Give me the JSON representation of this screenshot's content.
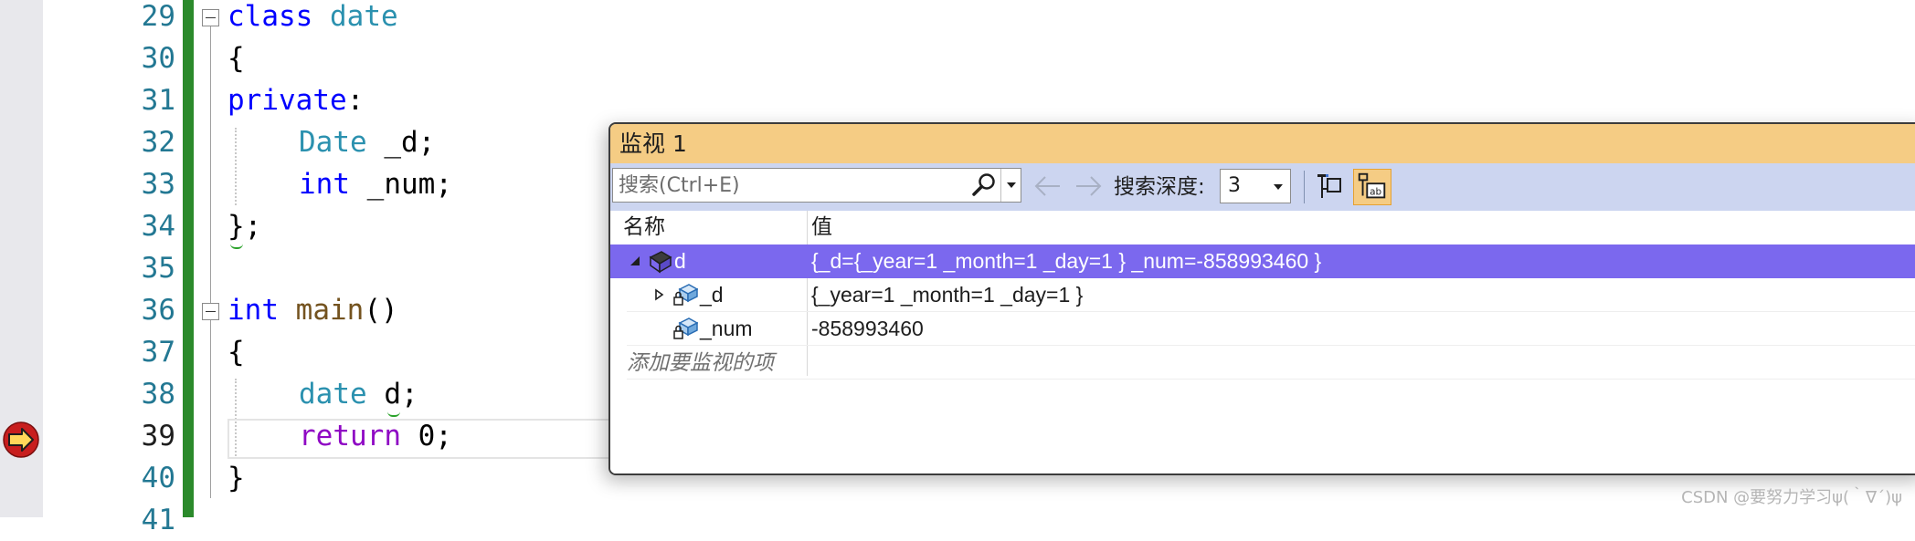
{
  "editor": {
    "line_numbers": [
      "29",
      "30",
      "31",
      "32",
      "33",
      "34",
      "35",
      "36",
      "37",
      "38",
      "39",
      "40",
      "41"
    ],
    "current_line": "39",
    "lines": {
      "l29": {
        "kw": "class",
        "name": "date"
      },
      "l30": {
        "text": "{"
      },
      "l31": {
        "kw": "private",
        "colon": ":"
      },
      "l32": {
        "type": "Date",
        "rest": " _d;"
      },
      "l33": {
        "kw": "int",
        "rest": " _num;"
      },
      "l34": {
        "text": "};"
      },
      "l36": {
        "kw": "int",
        "fn": "main",
        "rest": "()"
      },
      "l37": {
        "text": "{"
      },
      "l38": {
        "type": "date",
        "rest": " d;"
      },
      "l39": {
        "ctl": "return",
        "rest": " 0;"
      },
      "l40": {
        "text": "}"
      }
    },
    "colors": {
      "keyword": "#0000ff",
      "type": "#2b91af",
      "function": "#74531f",
      "control": "#8f08c4",
      "line_number": "#237893",
      "change_bar": "#2b8a2b"
    }
  },
  "watch": {
    "title": "监视 1",
    "search_placeholder": "搜索(Ctrl+E)",
    "depth_label": "搜索深度:",
    "depth_value": "3",
    "columns": {
      "name": "名称",
      "value": "值"
    },
    "rows": [
      {
        "name": "d",
        "value": "{_d={_year=1 _month=1 _day=1 } _num=-858993460 }",
        "icon": "object-icon",
        "expander": "expanded",
        "selected": true
      },
      {
        "name": "_d",
        "value": "{_year=1 _month=1 _day=1 }",
        "icon": "private-member-icon",
        "expander": "collapsed",
        "selected": false
      },
      {
        "name": "_num",
        "value": "-858993460",
        "icon": "private-member-icon",
        "expander": "none",
        "selected": false
      }
    ],
    "add_item_text": "添加要监视的项",
    "colors": {
      "title_bar": "#f5cc84",
      "toolbar": "#ccd5f0",
      "selection": "#7b68ee"
    }
  },
  "watermark": "CSDN @要努力学习ψ(｀∇´)ψ"
}
